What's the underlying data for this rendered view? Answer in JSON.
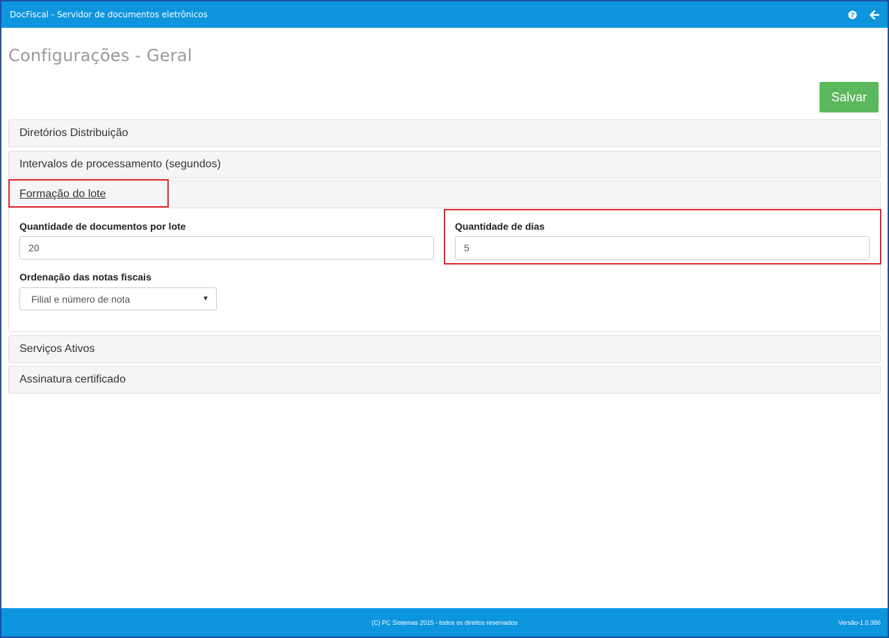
{
  "app": {
    "title": "DocFiscal - Servidor de documentos eletrônicos",
    "accent": "#0d95de"
  },
  "header_icons": [
    {
      "name": "help-icon"
    },
    {
      "name": "back-arrow-icon"
    }
  ],
  "page": {
    "title": "Configurações - Geral",
    "save_label": "Salvar",
    "save_color": "#5cb85c"
  },
  "sections": {
    "diretorios": "Diretórios Distribuição",
    "intervalos": "Intervalos de processamento (segundos)",
    "formacao": "Formação do lote",
    "servicos": "Serviços Ativos",
    "assinatura": "Assinatura certificado"
  },
  "formacao_lote": {
    "qtd_docs_label": "Quantidade de documentos por lote",
    "qtd_docs_value": "20",
    "qtd_dias_label": "Quantidade de dias",
    "qtd_dias_value": "5",
    "ordenacao_label": "Ordenação das notas fiscais",
    "ordenacao_value": "Filial e número de nota"
  },
  "highlight_color": "#e2252b",
  "footer": {
    "copyright": "(C) PC Sistemas 2015 - todos os direitos reservados",
    "version": "Versão-1.0.386"
  }
}
